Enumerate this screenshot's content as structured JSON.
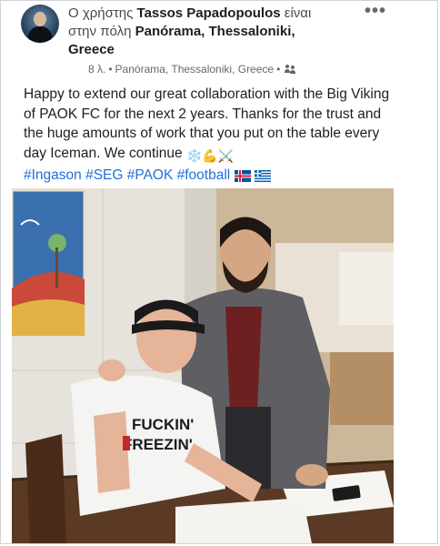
{
  "post": {
    "author_prefix": "Ο χρήστης",
    "author_name": "Tassos Papadopoulos",
    "author_suffix": "είναι",
    "location_prefix": "στην πόλη",
    "location_name": "Panórama, Thessaloniki,",
    "location_country": "Greece",
    "more_label": "•••",
    "time": "8 λ.",
    "meta_separator": "•",
    "meta_location": "Panórama, Thessaloniki, Greece",
    "meta_separator_2": "•",
    "audience_icon": "friends-icon",
    "body": "Happy to extend our great collaboration with the Big Viking of PAOK FC for the next 2 years. Thanks for the trust and the huge amounts of work that you put on the table every day Iceman. We continue",
    "body_emojis": "❄️💪⚔️",
    "hashtags": [
      "#Ingason",
      "#SEG",
      "#PAOK",
      "#football"
    ],
    "flag_emojis": [
      "iceland-flag-icon",
      "greece-flag-icon"
    ],
    "photo_shirt_text_1": "FUCKIN'",
    "photo_shirt_text_2": "FREEZIN'"
  },
  "colors": {
    "text": "#1c1e21",
    "muted": "#65676b",
    "hashtag": "#216fdb",
    "border": "#cfd3d8"
  }
}
